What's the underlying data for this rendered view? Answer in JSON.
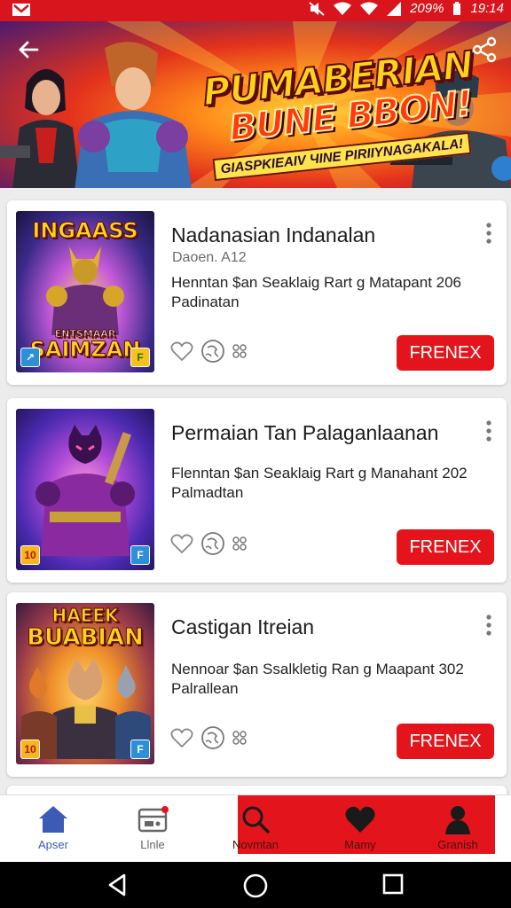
{
  "status_bar": {
    "battery_text": "209%",
    "time": "19:14"
  },
  "banner": {
    "title_line1": "PUMABERIAN",
    "title_line2": "BUNE BBON!",
    "subtitle": "GIASPKIEAIV ЧINE PIRIIYNAGAKALA!"
  },
  "cards": [
    {
      "title": "Nadanasian Indanalan",
      "developer": "Daoen. A12",
      "desc_line1": "Henntan $an Seaklaig Rart g Matapant 206",
      "desc_line2": "Padinatan",
      "cta": "FRENEX",
      "thumb_title_top": "INGAASS",
      "thumb_title_bottom": "SAIMZAN",
      "thumb_small_text": "ENTSMAAR",
      "badge_left": "↗",
      "badge_right": "F"
    },
    {
      "title": "Permaian Tan Palaganlaanan",
      "developer": "",
      "desc_line1": "Flenntan $an Seaklaig Rart g Manahant 202",
      "desc_line2": "Palmadtan",
      "cta": "FRENEX",
      "thumb_title_top": "",
      "thumb_title_bottom": "",
      "thumb_small_text": "",
      "badge_left": "10",
      "badge_right": "F"
    },
    {
      "title": "Castigan Itreian",
      "developer": "",
      "desc_line1": "Nennoar $an Ssalkletig Ran g Maapant 302",
      "desc_line2": "Palrallean",
      "cta": "FRENEX",
      "thumb_title_top": "HAEEK",
      "thumb_title_bottom": "BUABIAN",
      "thumb_small_text": "",
      "badge_left": "10",
      "badge_right": "F"
    }
  ],
  "bottom_nav": [
    {
      "label": "Apser",
      "icon": "home-icon"
    },
    {
      "label": "Llnle",
      "icon": "inbox-icon"
    },
    {
      "label": "Novmtan",
      "icon": "search-icon"
    },
    {
      "label": "Mamy",
      "icon": "heart-icon"
    },
    {
      "label": "Granish",
      "icon": "profile-icon"
    }
  ],
  "colors": {
    "accent": "#e3141b",
    "status_bar": "#d8151c",
    "nav_active": "#3b5bb5"
  }
}
